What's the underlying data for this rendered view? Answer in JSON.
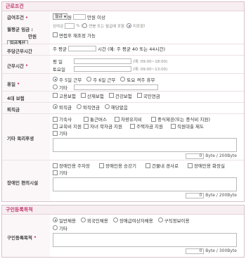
{
  "section1": {
    "title": "근로조건",
    "pay": {
      "label": "급여조건",
      "pay_type": "월급",
      "won": "원",
      "over": "만원 이상",
      "avg_label_line1": "월평균 임금 :",
      "avg_label_line2": "만원",
      "avg_button": "임금계산",
      "bonus_prefix": "상여금",
      "bonus_unit": "% (",
      "bonus_opt1": "연봉 또는 월급에 포함",
      "bonus_opt2": "미포함",
      "bonus_suffix": ")",
      "negotiable": "면접후 재조정 가능"
    },
    "hours": {
      "label": "주당근무시간",
      "prefix": "주 평균",
      "suffix": "시간 (예: 주 평균 40 또는 44시간)"
    },
    "worktime": {
      "label": "근무시간",
      "weekday": "평   일",
      "saturday": "토요일",
      "example_weekday": "(예: 09:00~18:00)",
      "example_saturday": "(예: 09:00~13:00)"
    },
    "holiday": {
      "label": "휴일",
      "options": [
        "주 5일 근무",
        "주 6일 근무",
        "토요 격주 휴무",
        "기타"
      ]
    },
    "insurance": {
      "label": "4대 보험",
      "options": [
        "고용보험",
        "산재보험",
        "건강보험",
        "국민연금"
      ]
    },
    "retirement": {
      "label": "퇴직금",
      "options": [
        "퇴직금",
        "퇴직연금",
        "해당없음"
      ]
    },
    "welfare": {
      "label": "기타 복리후생",
      "options": [
        "기숙사",
        "통근버스",
        "차량유지비",
        "중식제공(또는 중식비 지원)",
        "교육비 지원",
        "자녀 학자금 지원",
        "주택자금 지원",
        "직원대출 제도",
        "기타"
      ],
      "count": "0",
      "limit": "Byte / 200Byte"
    },
    "disabled": {
      "label": "장애인 편의시설",
      "options": [
        "장애인용 주차장",
        "장애인용 승강기",
        "건물내 경사로",
        "장애인용 화장실",
        "기타"
      ],
      "count": "0",
      "limit": "Byte / 200Byte"
    }
  },
  "section2": {
    "title": "구인등록목적",
    "purpose": {
      "label": "구인등록목적",
      "options": [
        "일반채용",
        "외국인채용",
        "장애급여상자채용",
        "구직정보이용",
        "기타"
      ],
      "count": "0",
      "limit": "Byte / 300Byte"
    }
  }
}
